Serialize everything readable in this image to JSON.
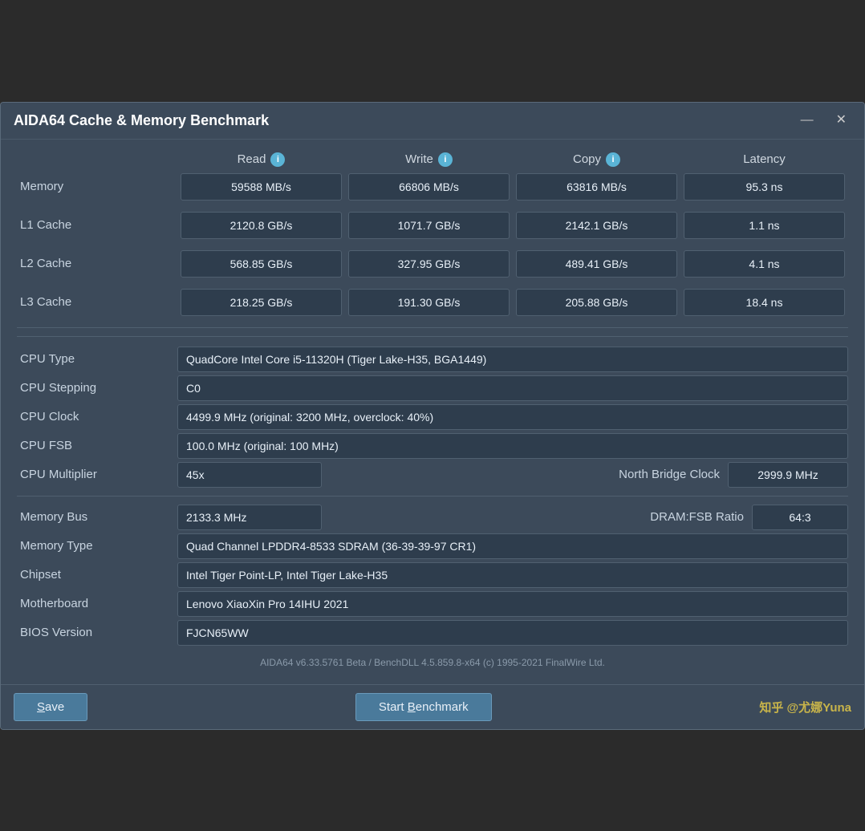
{
  "window": {
    "title": "AIDA64 Cache & Memory Benchmark",
    "minimize_label": "—",
    "close_label": "✕"
  },
  "header": {
    "col_empty": "",
    "col_read": "Read",
    "col_write": "Write",
    "col_copy": "Copy",
    "col_latency": "Latency"
  },
  "rows": [
    {
      "label": "Memory",
      "read": "59588 MB/s",
      "write": "66806 MB/s",
      "copy": "63816 MB/s",
      "latency": "95.3 ns"
    },
    {
      "label": "L1 Cache",
      "read": "2120.8 GB/s",
      "write": "1071.7 GB/s",
      "copy": "2142.1 GB/s",
      "latency": "1.1 ns"
    },
    {
      "label": "L2 Cache",
      "read": "568.85 GB/s",
      "write": "327.95 GB/s",
      "copy": "489.41 GB/s",
      "latency": "4.1 ns"
    },
    {
      "label": "L3 Cache",
      "read": "218.25 GB/s",
      "write": "191.30 GB/s",
      "copy": "205.88 GB/s",
      "latency": "18.4 ns"
    }
  ],
  "info": {
    "cpu_type_label": "CPU Type",
    "cpu_type_value": "QuadCore Intel Core i5-11320H  (Tiger Lake-H35, BGA1449)",
    "cpu_stepping_label": "CPU Stepping",
    "cpu_stepping_value": "C0",
    "cpu_clock_label": "CPU Clock",
    "cpu_clock_value": "4499.9 MHz  (original: 3200 MHz, overclock: 40%)",
    "cpu_fsb_label": "CPU FSB",
    "cpu_fsb_value": "100.0 MHz  (original: 100 MHz)",
    "cpu_multiplier_label": "CPU Multiplier",
    "cpu_multiplier_value": "45x",
    "north_bridge_label": "North Bridge Clock",
    "north_bridge_value": "2999.9 MHz",
    "memory_bus_label": "Memory Bus",
    "memory_bus_value": "2133.3 MHz",
    "dram_fsb_label": "DRAM:FSB Ratio",
    "dram_fsb_value": "64:3",
    "memory_type_label": "Memory Type",
    "memory_type_value": "Quad Channel LPDDR4-8533 SDRAM  (36-39-39-97 CR1)",
    "chipset_label": "Chipset",
    "chipset_value": "Intel Tiger Point-LP, Intel Tiger Lake-H35",
    "motherboard_label": "Motherboard",
    "motherboard_value": "Lenovo XiaoXin Pro 14IHU 2021",
    "bios_label": "BIOS Version",
    "bios_value": "FJCN65WW"
  },
  "footer": {
    "text": "AIDA64 v6.33.5761 Beta / BenchDLL 4.5.859.8-x64  (c) 1995-2021 FinalWire Ltd."
  },
  "buttons": {
    "save": "Save",
    "benchmark": "Start Benchmark"
  },
  "watermark": "知乎 @尤娜Yuna"
}
